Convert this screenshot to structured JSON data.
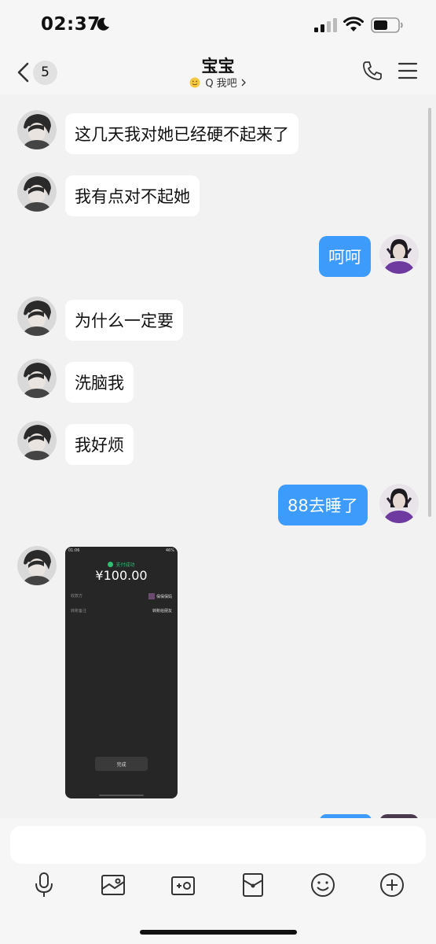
{
  "status_bar": {
    "time": "02:37",
    "icons": [
      "moon-icon",
      "cellular-signal-icon",
      "wifi-icon",
      "battery-icon"
    ]
  },
  "header": {
    "unread_count": "5",
    "title": "宝宝",
    "subtitle": "Q 我吧",
    "icons": [
      "back-chevron-icon",
      "phone-icon",
      "menu-icon"
    ]
  },
  "messages": [
    {
      "side": "in",
      "text": "这几天我对她已经硬不起来了"
    },
    {
      "side": "in",
      "text": "我有点对不起她"
    },
    {
      "side": "out",
      "text": "呵呵"
    },
    {
      "side": "in",
      "text": "为什么一定要"
    },
    {
      "side": "in",
      "text": "洗脑我"
    },
    {
      "side": "in",
      "text": "我好烦"
    },
    {
      "side": "out",
      "text": "88去睡了"
    }
  ],
  "image_message": {
    "status_time": "01:06",
    "status_battery": "46%",
    "success_label": "支付成功",
    "amount": "¥100.00",
    "payee_label": "收款方",
    "payee_name": "保保保妈",
    "note_label": "转账备注",
    "note_value": "转账给朋友",
    "done_label": "完成"
  },
  "input": {
    "placeholder": ""
  },
  "toolbar": {
    "icons": [
      "microphone-icon",
      "photo-icon",
      "camera-icon",
      "red-packet-icon",
      "emoji-icon",
      "plus-icon"
    ]
  },
  "colors": {
    "outgoing_bubble": "#3d9bfb",
    "incoming_bubble": "#ffffff",
    "chat_background": "#f2f2f2",
    "bar_background": "#f6f6f6",
    "payment_success": "#2fbf71"
  }
}
